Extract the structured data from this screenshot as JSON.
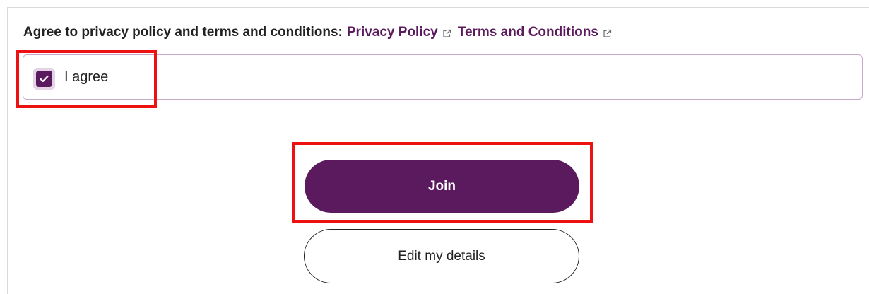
{
  "consent": {
    "prompt": "Agree to privacy policy and terms and conditions:",
    "privacy_link": "Privacy Policy",
    "terms_link": "Terms and Conditions",
    "link_icon": "external-link-icon",
    "checkbox_label": "I agree",
    "checkbox_checked": true
  },
  "actions": {
    "join_label": "Join",
    "edit_label": "Edit my details"
  },
  "colors": {
    "brand": "#5c1a5e",
    "highlight": "#ee1111"
  }
}
